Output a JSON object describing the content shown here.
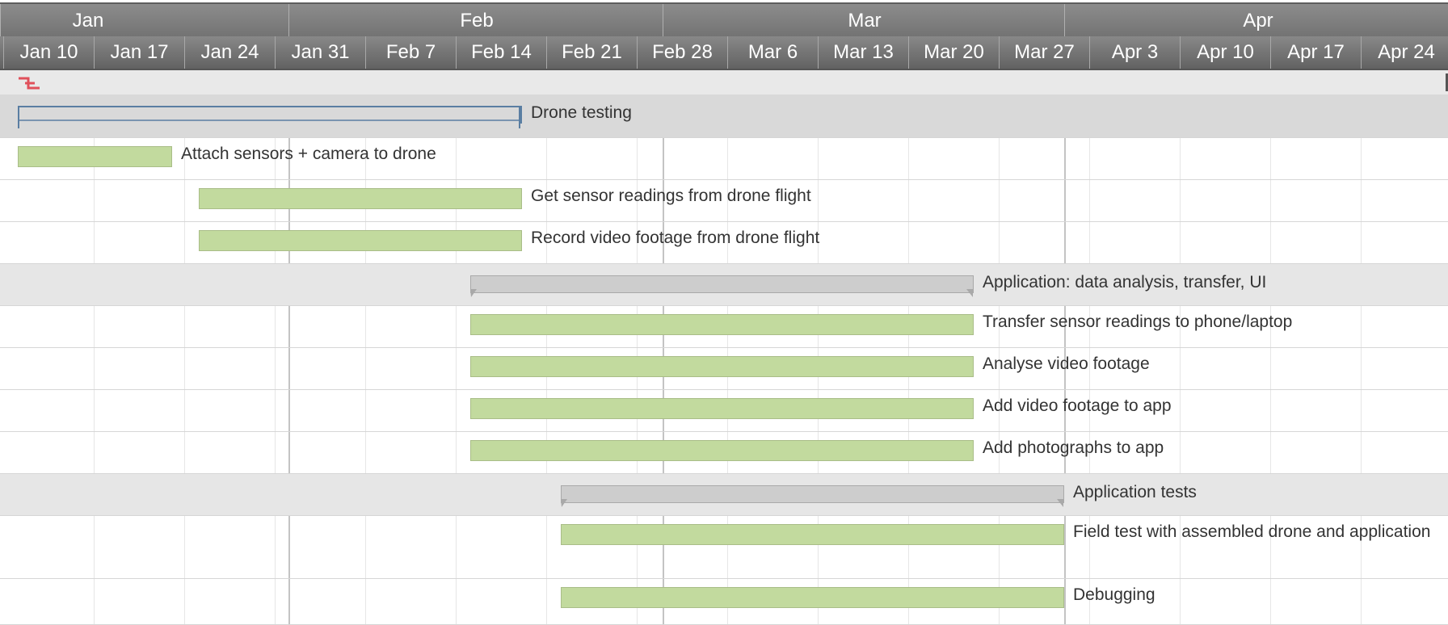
{
  "timeline": {
    "months": [
      "Jan",
      "Feb",
      "Mar",
      "Apr"
    ],
    "weeks": [
      "Jan 10",
      "Jan 17",
      "Jan 24",
      "Jan 31",
      "Feb 7",
      "Feb 14",
      "Feb 21",
      "Feb 28",
      "Mar 6",
      "Mar 13",
      "Mar 20",
      "Mar 27",
      "Apr 3",
      "Apr 10",
      "Apr 17",
      "Apr 24"
    ]
  },
  "toolbar": {
    "dependency_icon": "critical-path-icon"
  },
  "tasks": [
    {
      "name": "Drone testing",
      "type": "summary",
      "style": "blue"
    },
    {
      "name": "Attach sensors + camera to drone",
      "type": "task"
    },
    {
      "name": "Get sensor readings from drone flight",
      "type": "task"
    },
    {
      "name": "Record video footage from drone flight",
      "type": "task"
    },
    {
      "name": "Application: data analysis, transfer, UI",
      "type": "summary",
      "style": "gray"
    },
    {
      "name": "Transfer sensor readings to phone/laptop",
      "type": "task"
    },
    {
      "name": "Analyse video footage",
      "type": "task"
    },
    {
      "name": "Add video footage to app",
      "type": "task"
    },
    {
      "name": "Add photographs to app",
      "type": "task"
    },
    {
      "name": "Application tests",
      "type": "summary",
      "style": "gray"
    },
    {
      "name": "Field test with assembled drone and application",
      "type": "task"
    },
    {
      "name": "Debugging",
      "type": "task"
    }
  ],
  "colors": {
    "task_bar": "#c2da9e",
    "summary_blue": "#5a7ea2",
    "summary_gray": "#cdcdcd",
    "critical_icon": "#e0505a"
  }
}
